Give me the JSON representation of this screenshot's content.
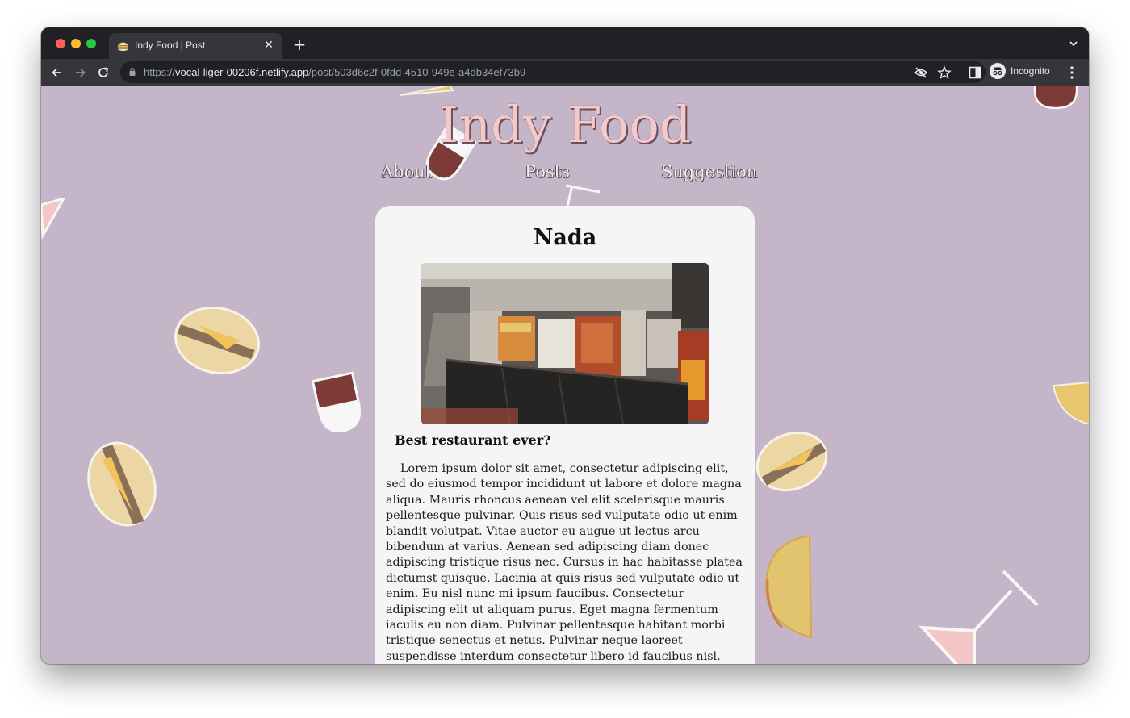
{
  "browser": {
    "tab_title": "Indy Food | Post",
    "tab_favicon": "burger-favicon",
    "url_scheme": "https://",
    "url_host": "vocal-liger-00206f.netlify.app",
    "url_path": "/post/503d6c2f-0fdd-4510-949e-a4db34ef73b9",
    "profile_label": "Incognito",
    "icons": [
      "back-arrow-icon",
      "forward-arrow-icon",
      "reload-icon",
      "lock-icon",
      "eye-off-icon",
      "star-icon",
      "side-panel-icon",
      "incognito-icon",
      "more-vert-icon",
      "new-tab-icon",
      "close-icon",
      "chevron-down-icon"
    ]
  },
  "site": {
    "title": "Indy Food",
    "nav": {
      "about": "About",
      "posts": "Posts",
      "suggestion": "Suggestion"
    },
    "background_color": "#c5b5c8",
    "title_color": "#f3c9c9"
  },
  "post": {
    "name": "Nada",
    "image_subject": "record-store-bins-photo",
    "subtitle": "Best restaurant ever?",
    "body": "Lorem ipsum dolor sit amet, consectetur adipiscing elit, sed do eiusmod tempor incididunt ut labore et dolore magna aliqua. Mauris rhoncus aenean vel elit scelerisque mauris pellentesque pulvinar. Quis risus sed vulputate odio ut enim blandit volutpat. Vitae auctor eu augue ut lectus arcu bibendum at varius. Aenean sed adipiscing diam donec adipiscing tristique risus nec. Cursus in hac habitasse platea dictumst quisque. Lacinia at quis risus sed vulputate odio ut enim. Eu nisl nunc mi ipsum faucibus. Consectetur adipiscing elit ut aliquam purus. Eget magna fermentum iaculis eu non diam. Pulvinar pellentesque habitant morbi tristique senectus et netus. Pulvinar neque laoreet suspendisse interdum consectetur libero id faucibus nisl. Pharetra pharetra massa massa ultricies. Dictum fusce ut placerat orci nulla pellentesque dignissim enim. Commodo viverra"
  },
  "decorations": [
    "burger-icon",
    "wine-glass-icon",
    "cocktail-glass-icon",
    "taco-icon"
  ]
}
